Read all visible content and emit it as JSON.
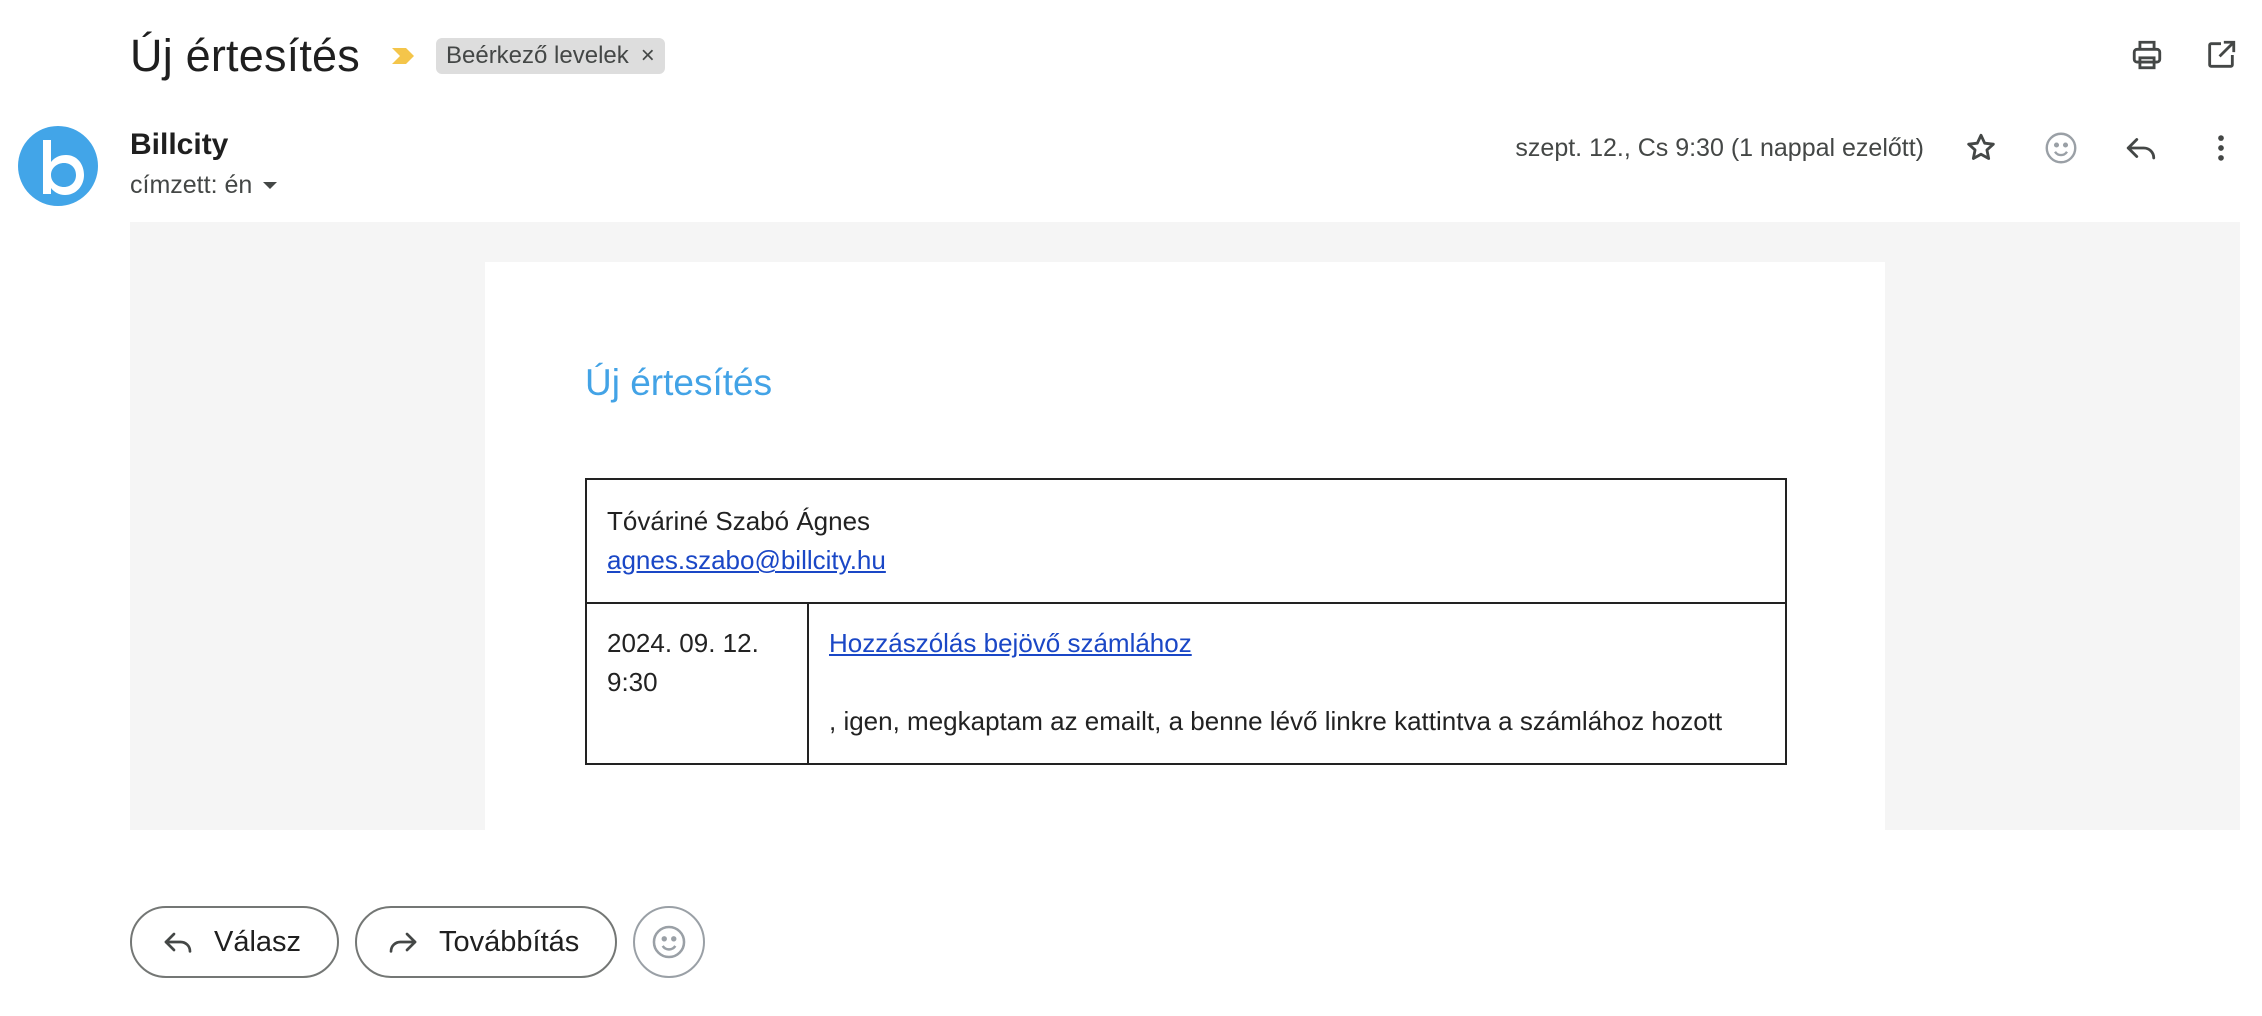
{
  "header": {
    "subject": "Új értesítés",
    "label": "Beérkező levelek",
    "label_remove": "×",
    "importance_color": "#f4c54a"
  },
  "toolbar_icons": [
    "print-icon",
    "open-in-new-window-icon"
  ],
  "sender": {
    "name": "Billcity",
    "recipient": "címzett: én",
    "avatar_letter": "b",
    "avatar_color": "#42a5e8",
    "date": "szept. 12., Cs 9:30 (1 nappal ezelőtt)"
  },
  "message_actions": [
    "star-icon",
    "emoji-icon",
    "reply-icon",
    "more-vert-icon"
  ],
  "email_body": {
    "title": "Új értesítés",
    "title_color": "#43a3e6",
    "author_name": "Tóváriné Szabó Ágnes",
    "author_email": "agnes.szabo@billcity.hu",
    "comment_date": "2024. 09. 12.",
    "comment_time": "9:30",
    "comment_link": "Hozzászólás bejövő számlához",
    "comment_text": ", igen, megkaptam az emailt, a benne lévő linkre kattintva a számlához hozott",
    "link_color": "#1a47c6"
  },
  "footer": {
    "reply_label": "Válasz",
    "forward_label": "Továbbítás"
  }
}
